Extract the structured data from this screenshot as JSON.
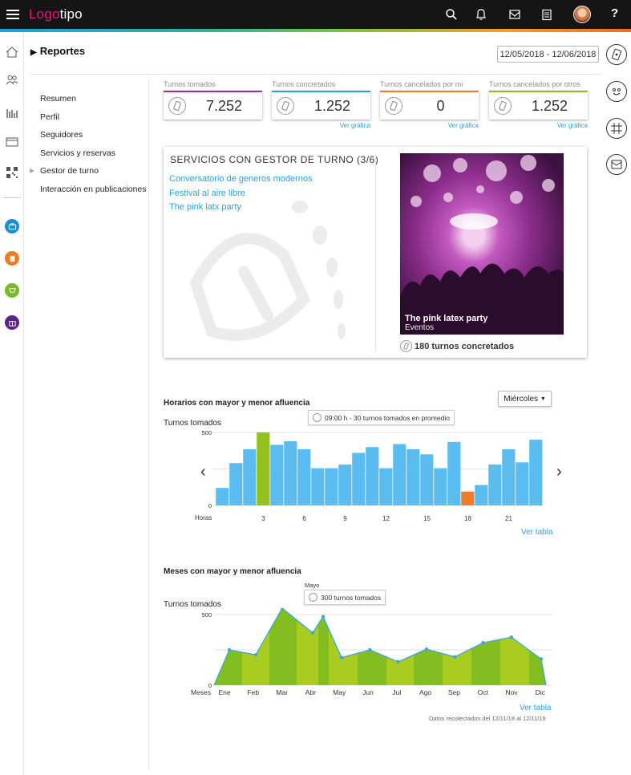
{
  "topbar": {
    "logo_part1": "Logo",
    "logo_part2": "tipo",
    "help_label": "?"
  },
  "page": {
    "title": "Reportes",
    "date_range": "12/05/2018 - 12/06/2018"
  },
  "left_nav": [
    "Resumen",
    "Perfil",
    "Seguidores",
    "Servicios y reservas",
    "Gestor de turno",
    "Interacción en publicaciones"
  ],
  "kpis": [
    {
      "label": "Turnos tomados",
      "value": "7.252",
      "link": "",
      "color": "#a72a84"
    },
    {
      "label": "Turnos concretados",
      "value": "1.252",
      "link": "Ver gráfica",
      "color": "#2d9fd9"
    },
    {
      "label": "Turnos cancelados por mi",
      "value": "0",
      "link": "Ver gráfica",
      "color": "#f07c2a"
    },
    {
      "label": "Turnos cancelados por otros",
      "value": "1.252",
      "link": "Ver gráfica",
      "color": "#84c22a"
    }
  ],
  "services_card": {
    "title": "SERVICIOS CON GESTOR DE TURNO (3/6)",
    "links": [
      "Conversatorio de generos modernos",
      "Festival al aire libre",
      "The pink latx party"
    ],
    "featured_title": "The pink latex party",
    "featured_category": "Eventos",
    "featured_stat": "180 turnos concretados"
  },
  "hours_section": {
    "title": "Horarios con mayor y menor afluencia",
    "ylabel": "Turnos tomados",
    "dropdown": "Miércoles",
    "tooltip": "09:00 h - 30 turnos tomados en promedio",
    "xaxis_label": "Horas",
    "link": "Ver tabla"
  },
  "months_section": {
    "title": "Meses con mayor y menor afluencia",
    "ylabel": "Turnos tomados",
    "tooltip_month": "Mayo",
    "tooltip": "300 turnos tomados",
    "xaxis_label": "Meses",
    "link": "Ver tabla",
    "footnote": "Datos recolectados del 12/11/18 al 12/11/19"
  },
  "chart_data": [
    {
      "type": "bar",
      "categories": [
        "0",
        "1",
        "2",
        "3",
        "4",
        "5",
        "6",
        "7",
        "8",
        "9",
        "10",
        "11",
        "12",
        "13",
        "14",
        "15",
        "16",
        "17",
        "18",
        "19",
        "20",
        "21",
        "22",
        "23"
      ],
      "values": [
        120,
        290,
        385,
        500,
        415,
        440,
        385,
        255,
        255,
        280,
        360,
        400,
        255,
        420,
        385,
        350,
        255,
        435,
        95,
        140,
        280,
        385,
        295,
        450
      ],
      "highlight_max_index": 3,
      "highlight_min_index": 18,
      "colors": {
        "default": "#5bbcef",
        "max": "#95c11f",
        "min": "#f07c2a"
      },
      "xticks": [
        "3",
        "6",
        "9",
        "12",
        "15",
        "18",
        "21"
      ],
      "yticks": [
        0,
        500
      ],
      "ylim": [
        0,
        500
      ],
      "ylabel": "Turnos tomados",
      "xlabel": "Horas"
    },
    {
      "type": "area",
      "categories": [
        "Ene",
        "Feb",
        "Mar",
        "Abr",
        "May",
        "Jun",
        "Jul",
        "Ago",
        "Sep",
        "Oct",
        "Nov",
        "Dic"
      ],
      "values": [
        250,
        215,
        545,
        370,
        485,
        195,
        250,
        165,
        255,
        200,
        300,
        340,
        185
      ],
      "x_positions_note": "13 points; extra peak between Abr and May",
      "colors": {
        "fill_a": "#84bd1f",
        "fill_b": "#a9cc21",
        "line": "#3aa7e0"
      },
      "yticks": [
        0,
        500
      ],
      "ylim": [
        0,
        500
      ],
      "ylabel": "Turnos tomados",
      "xlabel": "Meses"
    }
  ]
}
